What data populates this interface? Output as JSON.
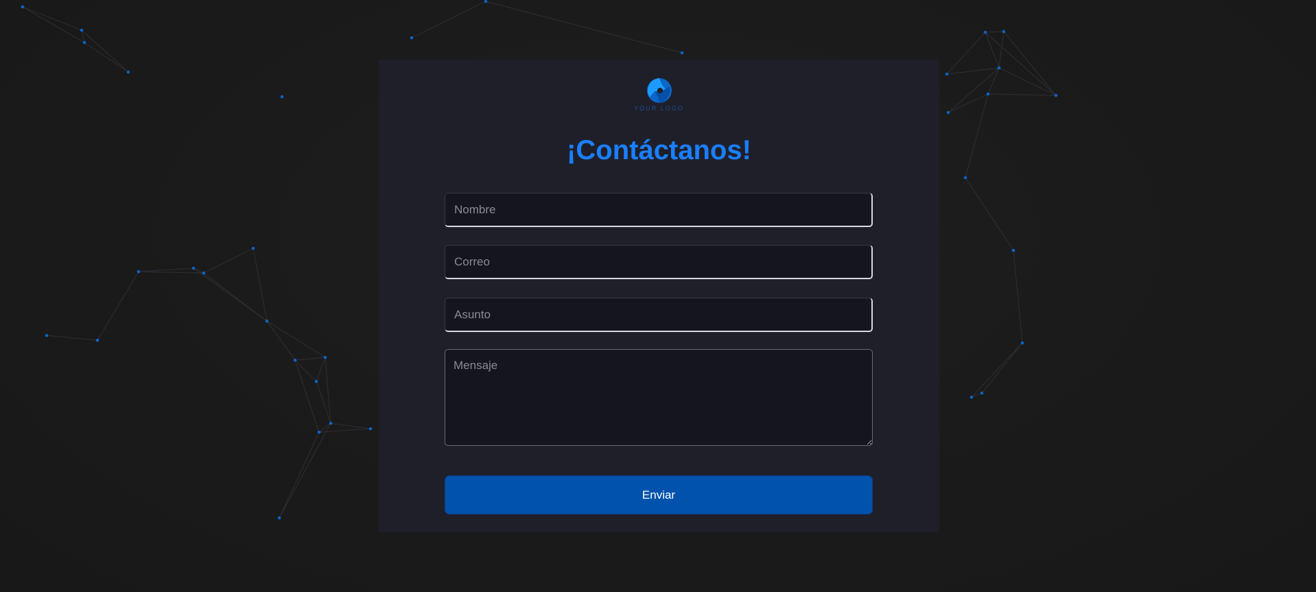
{
  "theme": {
    "accent": "#1a7fff",
    "button": "#0052ac",
    "card": "#1f1f2a",
    "field": "#15151f",
    "node": "#0b64c4",
    "link": "#2c2c32"
  },
  "logo": {
    "text": "YOUR LOGO",
    "icon": "swirl-logo-icon"
  },
  "form": {
    "title": "¡Contáctanos!",
    "fields": {
      "nombre": {
        "placeholder": "Nombre",
        "value": ""
      },
      "correo": {
        "placeholder": "Correo",
        "value": ""
      },
      "asunto": {
        "placeholder": "Asunto",
        "value": ""
      },
      "mensaje": {
        "placeholder": "Mensaje",
        "value": ""
      }
    },
    "submit_label": "Enviar"
  }
}
